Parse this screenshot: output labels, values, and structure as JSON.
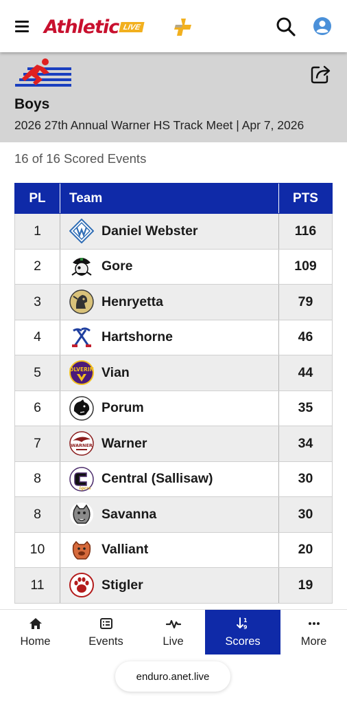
{
  "brand": {
    "name": "Athletic",
    "badge": "LIVE"
  },
  "header": {
    "title": "Boys",
    "subtitle": "2026 27th Annual Warner HS Track Meet | Apr 7, 2026"
  },
  "events_count": "16 of 16 Scored Events",
  "table": {
    "columns": {
      "pl": "PL",
      "team": "Team",
      "pts": "PTS"
    },
    "rows": [
      {
        "pl": "1",
        "team": "Daniel Webster",
        "pts": "116",
        "logo": "daniel-webster-logo"
      },
      {
        "pl": "2",
        "team": "Gore",
        "pts": "109",
        "logo": "gore-pirate-logo"
      },
      {
        "pl": "3",
        "team": "Henryetta",
        "pts": "79",
        "logo": "henryetta-knight-logo"
      },
      {
        "pl": "4",
        "team": "Hartshorne",
        "pts": "46",
        "logo": "hartshorne-miner-logo"
      },
      {
        "pl": "5",
        "team": "Vian",
        "pts": "44",
        "logo": "vian-wolverine-logo"
      },
      {
        "pl": "6",
        "team": "Porum",
        "pts": "35",
        "logo": "porum-panther-logo"
      },
      {
        "pl": "7",
        "team": "Warner",
        "pts": "34",
        "logo": "warner-eagle-logo"
      },
      {
        "pl": "8",
        "team": "Central (Sallisaw)",
        "pts": "30",
        "logo": "central-c-logo"
      },
      {
        "pl": "8",
        "team": "Savanna",
        "pts": "30",
        "logo": "savanna-bulldog-logo"
      },
      {
        "pl": "10",
        "team": "Valliant",
        "pts": "20",
        "logo": "valliant-bulldog-logo"
      },
      {
        "pl": "11",
        "team": "Stigler",
        "pts": "19",
        "logo": "stigler-paw-logo"
      }
    ]
  },
  "bottom_nav": {
    "home": "Home",
    "events": "Events",
    "live": "Live",
    "scores": "Scores",
    "more": "More"
  },
  "browser": {
    "url": "enduro.anet.live"
  },
  "colors": {
    "primary": "#0f2aa8",
    "brand_red": "#c8102e",
    "brand_gold": "#f2b01e",
    "header_bg": "#d4d4d4"
  }
}
